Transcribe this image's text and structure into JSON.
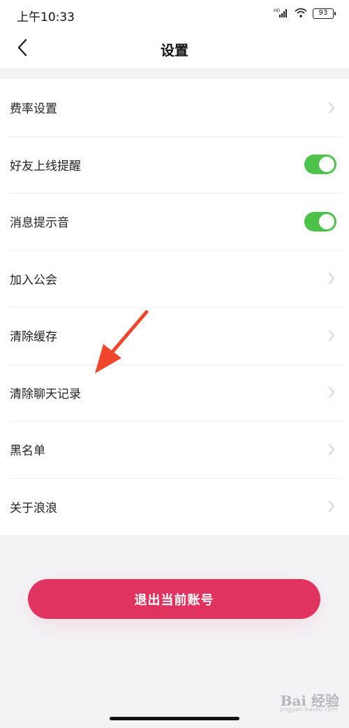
{
  "status_bar": {
    "time": "上午10:33",
    "battery": "93",
    "network": "HD"
  },
  "header": {
    "title": "设置",
    "back_icon": "chevron-left-icon"
  },
  "settings": {
    "items": [
      {
        "label": "费率设置",
        "control": "chevron"
      },
      {
        "label": "好友上线提醒",
        "control": "toggle",
        "on": true
      },
      {
        "label": "消息提示音",
        "control": "toggle",
        "on": true
      },
      {
        "label": "加入公会",
        "control": "chevron"
      },
      {
        "label": "清除缓存",
        "control": "chevron"
      },
      {
        "label": "清除聊天记录",
        "control": "chevron"
      },
      {
        "label": "黑名单",
        "control": "chevron"
      },
      {
        "label": "关于浪浪",
        "control": "chevron"
      }
    ]
  },
  "logout": {
    "label": "退出当前账号"
  },
  "watermark": {
    "brand": "Bai 经验",
    "url": "jingyan.baidu.com"
  },
  "colors": {
    "accent": "#e0335f",
    "toggle_on": "#4cc24a",
    "annotation_arrow": "#f0472c",
    "background": "#f3f3f6"
  }
}
